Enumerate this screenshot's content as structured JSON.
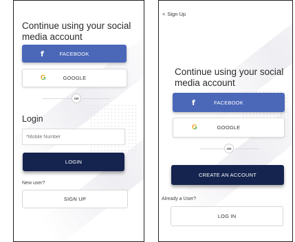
{
  "left_screen": {
    "heading": "Continue using your social media account",
    "facebook": {
      "icon": "f",
      "label": "FACEBOOK"
    },
    "google": {
      "icon": "G",
      "label": "GOOGLE"
    },
    "divider_label": "OR",
    "login_title": "Login",
    "mobile_input": {
      "placeholder": "*Mobile Number",
      "value": ""
    },
    "login_button": "LOGIN",
    "new_user_text": "New user?",
    "signup_button": "SIGN UP"
  },
  "right_screen": {
    "back_icon": "<",
    "back_label": "Sign Up",
    "heading": "Continue using your social media account",
    "facebook": {
      "icon": "f",
      "label": "FACEBOOK"
    },
    "google": {
      "icon": "G",
      "label": "GOOGLE"
    },
    "divider_label": "OR",
    "create_account_button": "CREATE AN ACCOUNT",
    "already_user_text": "Already a User?",
    "login_button": "LOG IN"
  },
  "colors": {
    "facebook_blue": "#4a67b8",
    "navy": "#15234f",
    "frame_border": "#1f1f1f"
  },
  "icons": {
    "facebook": "facebook-icon",
    "google": "google-icon",
    "back": "chevron-left-icon"
  }
}
